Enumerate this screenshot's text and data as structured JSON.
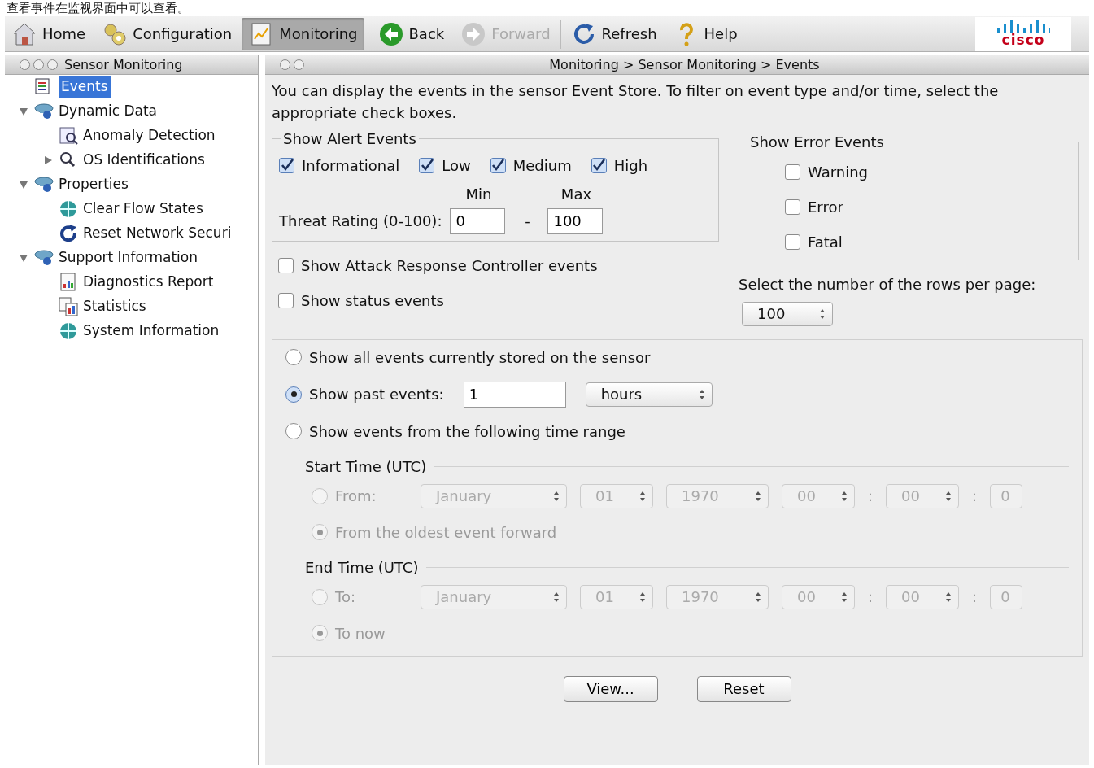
{
  "caption": "查看事件在监视界面中可以查看。",
  "toolbar": [
    {
      "label": "Home",
      "kind": "home",
      "selected": false,
      "disabled": false
    },
    {
      "label": "Configuration",
      "kind": "gears",
      "selected": false,
      "disabled": false
    },
    {
      "label": "Monitoring",
      "kind": "monitor",
      "selected": true,
      "disabled": false
    },
    {
      "label": "Back",
      "kind": "back",
      "selected": false,
      "disabled": false
    },
    {
      "label": "Forward",
      "kind": "forward",
      "selected": false,
      "disabled": true
    },
    {
      "label": "Refresh",
      "kind": "refresh",
      "selected": false,
      "disabled": false
    },
    {
      "label": "Help",
      "kind": "help",
      "selected": false,
      "disabled": false
    }
  ],
  "logo": "cisco",
  "sidebar": {
    "title": "Sensor Monitoring",
    "items": [
      {
        "label": "Events",
        "kind": "list",
        "selected": true
      },
      {
        "label": "Dynamic Data",
        "kind": "folder",
        "selected": false,
        "expanded": true,
        "children": [
          {
            "label": "Anomaly Detection",
            "kind": "chart",
            "selected": false
          },
          {
            "label": "OS Identifications",
            "kind": "search",
            "selected": false,
            "expanded": false
          }
        ]
      },
      {
        "label": "Properties",
        "kind": "folder",
        "selected": false,
        "expanded": true,
        "children": [
          {
            "label": "Clear Flow States",
            "kind": "globe",
            "selected": false
          },
          {
            "label": "Reset Network Securi",
            "kind": "reset",
            "selected": false
          }
        ]
      },
      {
        "label": "Support Information",
        "kind": "folder",
        "selected": false,
        "expanded": true,
        "children": [
          {
            "label": "Diagnostics Report",
            "kind": "report",
            "selected": false
          },
          {
            "label": "Statistics",
            "kind": "stats",
            "selected": false
          },
          {
            "label": "System Information",
            "kind": "globe",
            "selected": false
          }
        ]
      }
    ]
  },
  "panel": {
    "title": "Monitoring > Sensor Monitoring > Events",
    "description": "You can display the events in the sensor Event Store. To filter on event type and/or time, select the appropriate check boxes.",
    "alert_events": {
      "title": "Show Alert Events",
      "levels": [
        {
          "label": "Informational",
          "checked": true
        },
        {
          "label": "Low",
          "checked": true
        },
        {
          "label": "Medium",
          "checked": true
        },
        {
          "label": "High",
          "checked": true
        }
      ],
      "min_label": "Min",
      "max_label": "Max",
      "threat_label": "Threat Rating (0-100):",
      "min_value": "0",
      "separator": "-",
      "max_value": "100"
    },
    "error_events": {
      "title": "Show Error Events",
      "items": [
        {
          "label": "Warning",
          "checked": false
        },
        {
          "label": "Error",
          "checked": false
        },
        {
          "label": "Fatal",
          "checked": false
        }
      ]
    },
    "options": [
      {
        "label": "Show Attack Response Controller events",
        "checked": false
      },
      {
        "label": "Show status events",
        "checked": false
      }
    ],
    "rows_per_page": {
      "label": "Select the number of the rows per page:",
      "value": "100"
    },
    "time_filter": [
      {
        "kind": "all",
        "label": "Show all events currently stored on the sensor",
        "selected": false
      },
      {
        "kind": "past",
        "label": "Show past events:",
        "selected": true,
        "value": "1",
        "unit": "hours"
      },
      {
        "kind": "range",
        "label": "Show events from the following time range",
        "selected": false
      }
    ],
    "ranges": [
      {
        "title": "Start Time (UTC)",
        "disabled": true,
        "separator": ":",
        "options": [
          {
            "kind": "date",
            "label": "From:",
            "selected": false,
            "fields": [
              "January",
              "01",
              "1970",
              "00",
              "00",
              "0"
            ]
          },
          {
            "kind": "plain",
            "label": "From the oldest event forward",
            "selected": true
          }
        ]
      },
      {
        "title": "End Time (UTC)",
        "disabled": true,
        "separator": ":",
        "options": [
          {
            "kind": "date",
            "label": "To:",
            "selected": false,
            "fields": [
              "January",
              "01",
              "1970",
              "00",
              "00",
              "0"
            ]
          },
          {
            "kind": "plain",
            "label": "To now",
            "selected": true
          }
        ]
      }
    ],
    "buttons": [
      "View...",
      "Reset"
    ]
  }
}
